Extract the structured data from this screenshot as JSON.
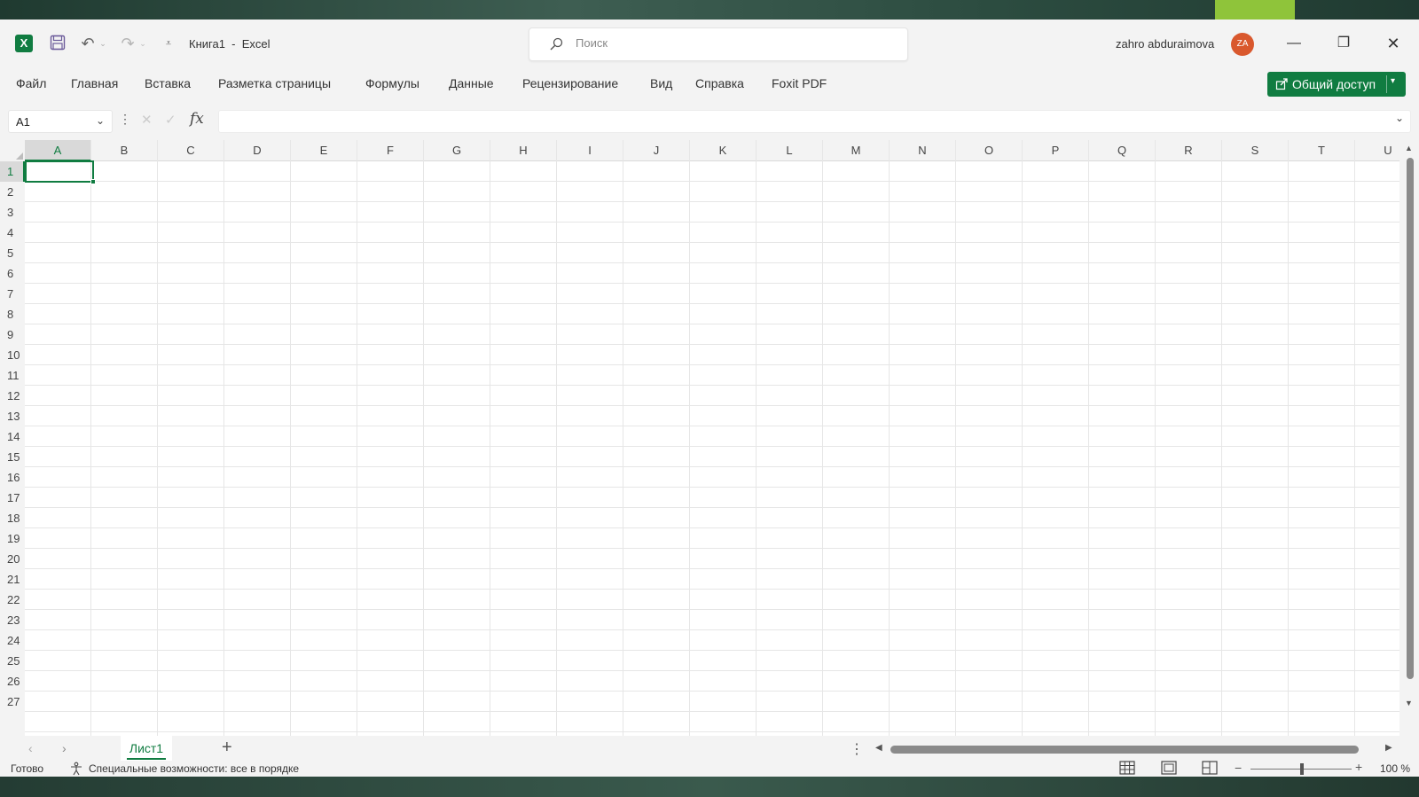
{
  "window": {
    "doc_title": "Книга1  -  Excel",
    "user_name": "zahro abduraimova",
    "avatar_initials": "ZA",
    "colors": {
      "accent": "#107c41",
      "avatar": "#d9582d",
      "desktop_accent": "#8fc43a"
    }
  },
  "search": {
    "placeholder": "Поиск"
  },
  "ribbon": {
    "tabs": [
      "Файл",
      "Главная",
      "Вставка",
      "Разметка страницы",
      "Формулы",
      "Данные",
      "Рецензирование",
      "Вид",
      "Справка",
      "Foxit PDF"
    ],
    "share_label": "Общий доступ"
  },
  "formula_bar": {
    "name_box": "A1",
    "fx_label": "fx",
    "formula": ""
  },
  "grid": {
    "columns": [
      "A",
      "B",
      "C",
      "D",
      "E",
      "F",
      "G",
      "H",
      "I",
      "J",
      "K",
      "L",
      "M",
      "N",
      "O",
      "P",
      "Q",
      "R",
      "S",
      "T",
      "U"
    ],
    "rows": [
      "1",
      "2",
      "3",
      "4",
      "5",
      "6",
      "7",
      "8",
      "9",
      "10",
      "11",
      "12",
      "13",
      "14",
      "15",
      "16",
      "17",
      "18",
      "19",
      "20",
      "21",
      "22",
      "23",
      "24",
      "25",
      "26",
      "27"
    ],
    "selected_cell": "A1"
  },
  "sheets": {
    "tabs": [
      "Лист1"
    ],
    "active": "Лист1"
  },
  "status": {
    "ready": "Готово",
    "accessibility": "Специальные возможности: все в порядке",
    "zoom": "100 %"
  },
  "icons": [
    "excel-logo-icon",
    "save-icon",
    "undo-icon",
    "redo-icon",
    "customize-icon",
    "search-icon",
    "minimize-icon",
    "maximize-icon",
    "close-icon",
    "share-icon",
    "chevron-down-icon",
    "fx-icon",
    "plus-icon",
    "accessibility-icon",
    "normal-view-icon",
    "page-layout-icon",
    "page-break-icon"
  ]
}
